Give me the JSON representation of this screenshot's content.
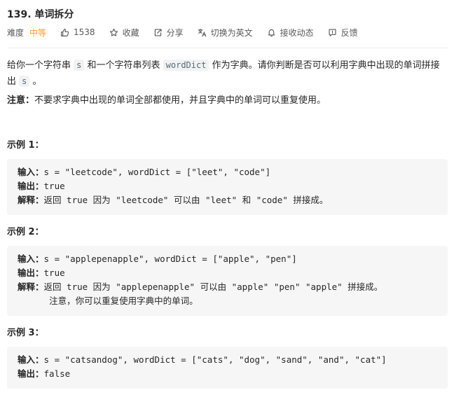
{
  "problem": {
    "title": "139. 单词拆分",
    "difficulty_label": "难度",
    "difficulty": "中等",
    "likes": "1538",
    "collect": "收藏",
    "share": "分享",
    "switch_lang": "切换为英文",
    "subscribe": "接收动态",
    "feedback": "反馈"
  },
  "colors": {
    "difficulty": "#ffa116",
    "code_bg": "#f2f2f2",
    "example_bg": "#f6f6f6"
  },
  "description": {
    "p1_a": "给你一个字符串 ",
    "p1_code1": "s",
    "p1_b": " 和一个字符串列表 ",
    "p1_code2": "wordDict",
    "p1_c": " 作为字典。请你判断是否可以利用字典中出现的单词拼接出 ",
    "p1_code3": "s",
    "p1_d": " 。",
    "note_label": "注意：",
    "note_text": "不要求字典中出现的单词全部都使用，并且字典中的单词可以重复使用。"
  },
  "examples": [
    {
      "title": "示例 1：",
      "input_label": "输入：",
      "input": "s = \"leetcode\", wordDict = [\"leet\", \"code\"]",
      "output_label": "输出：",
      "output": "true",
      "explain_label": "解释：",
      "explain": "返回 true 因为 \"leetcode\" 可以由 \"leet\" 和 \"code\" 拼接成。"
    },
    {
      "title": "示例 2：",
      "input_label": "输入：",
      "input": "s = \"applepenapple\", wordDict = [\"apple\", \"pen\"]",
      "output_label": "输出：",
      "output": "true",
      "explain_label": "解释：",
      "explain": "返回 true 因为 \"applepenapple\" 可以由 \"apple\" \"pen\" \"apple\" 拼接成。",
      "explain2": "注意，你可以重复使用字典中的单词。"
    },
    {
      "title": "示例 3：",
      "input_label": "输入：",
      "input": "s = \"catsandog\", wordDict = [\"cats\", \"dog\", \"sand\", \"and\", \"cat\"]",
      "output_label": "输出：",
      "output": "false"
    }
  ]
}
